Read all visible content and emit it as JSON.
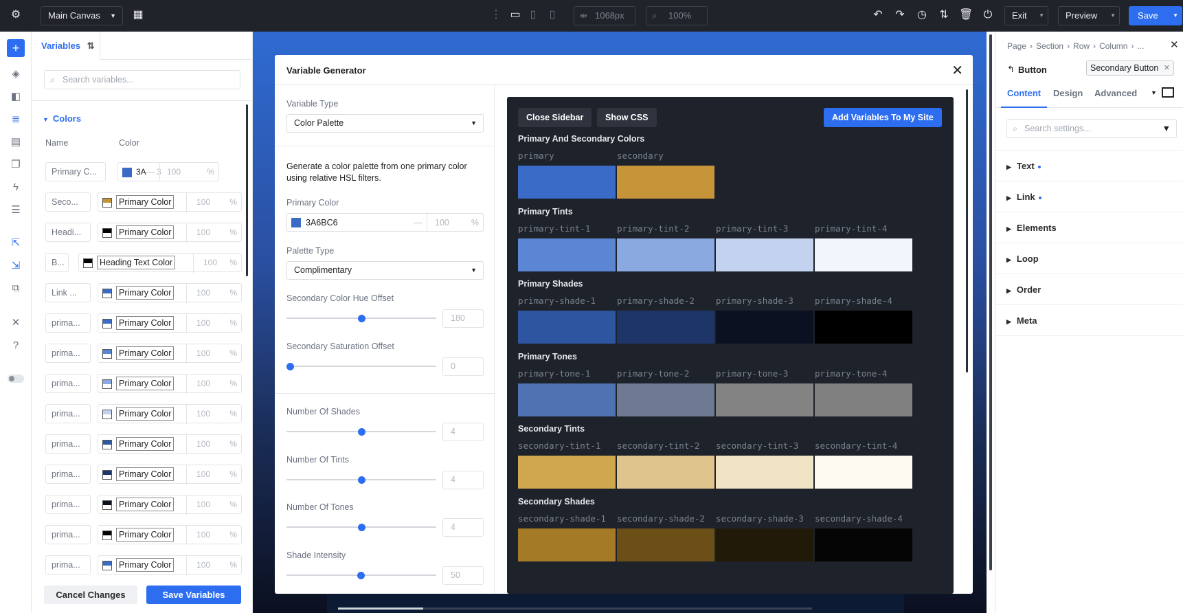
{
  "topbar": {
    "canvas_select": "Main Canvas",
    "width_value": "1068px",
    "zoom_value": "100%",
    "exit_label": "Exit",
    "preview_label": "Preview",
    "save_label": "Save"
  },
  "variables_panel": {
    "tab_label": "Variables",
    "search_placeholder": "Search variables...",
    "group_label": "Colors",
    "col_name": "Name",
    "col_color": "Color",
    "first_row": {
      "name": "Primary C...",
      "hex": "3A",
      "pct": "100",
      "pct_sign": "%"
    },
    "rows": [
      {
        "name": "Seco...",
        "tag": "Primary Color",
        "pct": "100",
        "pct_sign": "%"
      },
      {
        "name": "Headi...",
        "tag": "Primary Color",
        "pct": "100",
        "pct_sign": "%"
      },
      {
        "name": "B...",
        "tag": "Heading Text Color",
        "pct": "100",
        "pct_sign": "%"
      },
      {
        "name": "Link ...",
        "tag": "Primary Color",
        "pct": "100",
        "pct_sign": "%"
      },
      {
        "name": "prima...",
        "tag": "Primary Color",
        "pct": "100",
        "pct_sign": "%"
      },
      {
        "name": "prima...",
        "tag": "Primary Color",
        "pct": "100",
        "pct_sign": "%"
      },
      {
        "name": "prima...",
        "tag": "Primary Color",
        "pct": "100",
        "pct_sign": "%"
      },
      {
        "name": "prima...",
        "tag": "Primary Color",
        "pct": "100",
        "pct_sign": "%"
      },
      {
        "name": "prima...",
        "tag": "Primary Color",
        "pct": "100",
        "pct_sign": "%"
      },
      {
        "name": "prima...",
        "tag": "Primary Color",
        "pct": "100",
        "pct_sign": "%"
      },
      {
        "name": "prima...",
        "tag": "Primary Color",
        "pct": "100",
        "pct_sign": "%"
      },
      {
        "name": "prima...",
        "tag": "Primary Color",
        "pct": "100",
        "pct_sign": "%"
      },
      {
        "name": "prima...",
        "tag": "Primary Color",
        "pct": "100",
        "pct_sign": "%"
      }
    ],
    "cancel_label": "Cancel Changes",
    "save_label": "Save Variables"
  },
  "generator": {
    "title": "Variable Generator",
    "variable_type_label": "Variable Type",
    "variable_type_value": "Color Palette",
    "description": "Generate a color palette from one primary color using relative HSL filters.",
    "primary_color_label": "Primary Color",
    "primary_color_hex": "3A6BC6",
    "primary_color_pct": "100",
    "palette_type_label": "Palette Type",
    "palette_type_value": "Complimentary",
    "hue_offset_label": "Secondary Color Hue Offset",
    "hue_offset_value": "180",
    "sat_offset_label": "Secondary Saturation Offset",
    "sat_offset_value": "0",
    "shades_label": "Number Of Shades",
    "shades_value": "4",
    "tints_label": "Number Of Tints",
    "tints_value": "4",
    "tones_label": "Number Of Tones",
    "tones_value": "4",
    "intensity_label": "Shade Intensity",
    "intensity_value": "50",
    "close_sidebar_label": "Close Sidebar",
    "show_css_label": "Show CSS",
    "add_label": "Add Variables To My Site",
    "groups": [
      {
        "title": "Primary And Secondary Colors",
        "swatches": [
          {
            "name": "primary",
            "color": "#3a6bc6"
          },
          {
            "name": "secondary",
            "color": "#c6953a"
          }
        ]
      },
      {
        "title": "Primary Tints",
        "swatches": [
          {
            "name": "primary-tint-1",
            "color": "#5a86d4"
          },
          {
            "name": "primary-tint-2",
            "color": "#8aa9e0"
          },
          {
            "name": "primary-tint-3",
            "color": "#c2d2ef"
          },
          {
            "name": "primary-tint-4",
            "color": "#f2f5fb"
          }
        ]
      },
      {
        "title": "Primary Shades",
        "swatches": [
          {
            "name": "primary-shade-1",
            "color": "#2d55a0"
          },
          {
            "name": "primary-shade-2",
            "color": "#1d3568"
          },
          {
            "name": "primary-shade-3",
            "color": "#0b1120"
          },
          {
            "name": "primary-shade-4",
            "color": "#000000"
          }
        ]
      },
      {
        "title": "Primary Tones",
        "swatches": [
          {
            "name": "primary-tone-1",
            "color": "#4f72b3"
          },
          {
            "name": "primary-tone-2",
            "color": "#6e7a93"
          },
          {
            "name": "primary-tone-3",
            "color": "#838383"
          },
          {
            "name": "primary-tone-4",
            "color": "#808080"
          }
        ]
      },
      {
        "title": "Secondary Tints",
        "swatches": [
          {
            "name": "secondary-tint-1",
            "color": "#d0a64f"
          },
          {
            "name": "secondary-tint-2",
            "color": "#e0c48e"
          },
          {
            "name": "secondary-tint-3",
            "color": "#f1e3c5"
          },
          {
            "name": "secondary-tint-4",
            "color": "#fcf9f1"
          }
        ]
      },
      {
        "title": "Secondary Shades",
        "swatches": [
          {
            "name": "secondary-shade-1",
            "color": "#a57a27"
          },
          {
            "name": "secondary-shade-2",
            "color": "#6b4f17"
          },
          {
            "name": "secondary-shade-3",
            "color": "#221a09"
          },
          {
            "name": "secondary-shade-4",
            "color": "#050505"
          }
        ]
      }
    ]
  },
  "right_panel": {
    "breadcrumb": [
      "Page",
      "Section",
      "Row",
      "Column",
      "..."
    ],
    "element_name": "Button",
    "preset_tag": "Secondary Button",
    "tabs": [
      "Content",
      "Design",
      "Advanced"
    ],
    "search_placeholder": "Search settings...",
    "sections": [
      "Text",
      "Link",
      "Elements",
      "Loop",
      "Order",
      "Meta"
    ]
  },
  "colors": {
    "accent": "#2d6ef0",
    "topbar": "#20232a",
    "preview_bg": "#1e222a"
  }
}
